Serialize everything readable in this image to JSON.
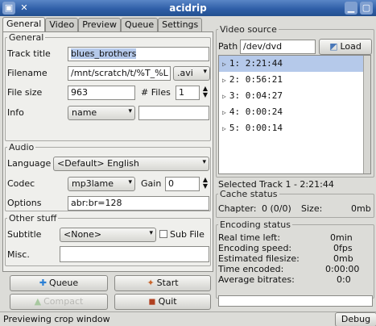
{
  "window": {
    "title": "acidrip"
  },
  "tabs": [
    "General",
    "Video",
    "Preview",
    "Queue",
    "Settings"
  ],
  "general": {
    "legend": "General",
    "track_title_label": "Track title",
    "track_title_value": "blues_brothers",
    "filename_label": "Filename",
    "filename_value": "/mnt/scratch/t/%T_%L",
    "filename_ext": ".avi",
    "filesize_label": "File size",
    "filesize_value": "963",
    "files_label": "# Files",
    "files_value": "1",
    "info_label": "Info",
    "info_value": "name"
  },
  "audio": {
    "legend": "Audio",
    "language_label": "Language",
    "language_value": "<Default> English",
    "codec_label": "Codec",
    "codec_value": "mp3lame",
    "gain_label": "Gain",
    "gain_value": "0",
    "options_label": "Options",
    "options_value": "abr:br=128"
  },
  "other": {
    "legend": "Other stuff",
    "subtitle_label": "Subtitle",
    "subtitle_value": "<None>",
    "subfile_label": "Sub File",
    "misc_label": "Misc.",
    "misc_value": ""
  },
  "buttons": {
    "queue": "Queue",
    "start": "Start",
    "compact": "Compact",
    "quit": "Quit",
    "load": "Load"
  },
  "video_source": {
    "legend": "Video source",
    "path_label": "Path",
    "path_value": "/dev/dvd",
    "tracks": [
      "1: 2:21:44",
      "2: 0:56:21",
      "3: 0:04:27",
      "4: 0:00:24",
      "5: 0:00:14"
    ],
    "selected_track": "Selected Track 1 - 2:21:44"
  },
  "cache": {
    "legend": "Cache status",
    "chapter_label": "Chapter:",
    "chapter_value": "0 (0/0)",
    "size_label": "Size:",
    "size_value": "0mb"
  },
  "encoding": {
    "legend": "Encoding status",
    "rows": [
      {
        "label": "Real time left:",
        "value": "0min"
      },
      {
        "label": "Encoding speed:",
        "value": "0fps"
      },
      {
        "label": "Estimated filesize:",
        "value": "0mb"
      },
      {
        "label": "Time encoded:",
        "value": "0:00:00"
      },
      {
        "label": "Average bitrates:",
        "value": "0:0"
      }
    ]
  },
  "statusbar": {
    "message": "Previewing crop window",
    "debug": "Debug"
  }
}
